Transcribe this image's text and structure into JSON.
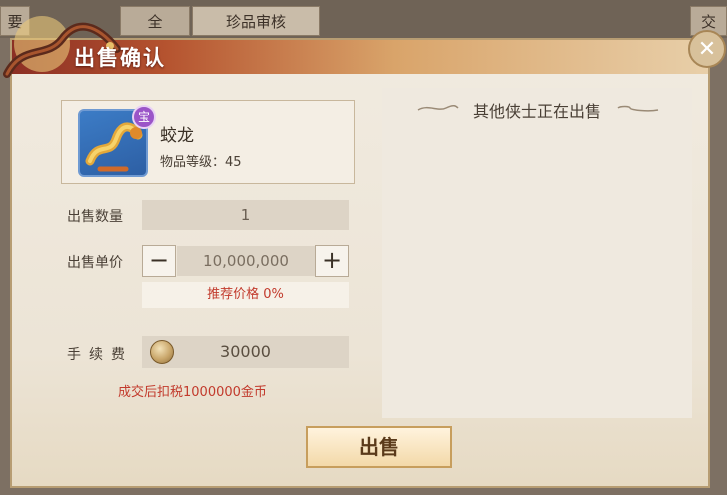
{
  "background": {
    "tab_left": "要",
    "tab_mid": "全",
    "tab_review": "珍品审核",
    "tab_right": "交"
  },
  "dialog": {
    "title": "出售确认",
    "close_symbol": "✕"
  },
  "item": {
    "name": "蛟龙",
    "level_text": "物品等级：45",
    "badge": "宝"
  },
  "form": {
    "quantity_label": "出售数量",
    "quantity_value": "1",
    "price_label": "出售单价",
    "price_value": "10,000,000",
    "minus_symbol": "−",
    "plus_symbol": "+",
    "recommend_text": "推荐价格 0%",
    "fee_label": "手续费",
    "fee_value": "30000",
    "tax_note": "成交后扣税1000000金币"
  },
  "others": {
    "title": "其他侠士正在出售"
  },
  "actions": {
    "sell_label": "出售"
  },
  "colors": {
    "title_band_start": "#8c2f24",
    "warning_red": "#c23a2c",
    "button_gold": "#f3d9a9"
  }
}
